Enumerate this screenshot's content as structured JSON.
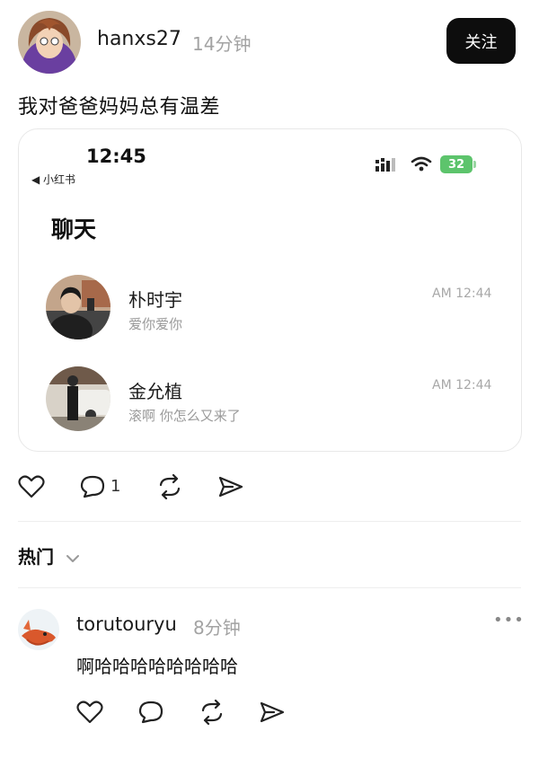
{
  "post": {
    "username": "hanxs27",
    "time": "14分钟",
    "follow_label": "关注",
    "text": "我对爸爸妈妈总有温差"
  },
  "screenshot": {
    "clock": "12:45",
    "back_label": "◀ 小红书",
    "battery": "32",
    "title": "聊天",
    "chats": [
      {
        "name": "朴时宇",
        "preview": "爱你爱你",
        "time": "AM 12:44"
      },
      {
        "name": "金允植",
        "preview": "滚啊 你怎么又来了",
        "time": "AM 12:44"
      }
    ]
  },
  "actions": {
    "comment_count": "1"
  },
  "sort": {
    "label": "热门"
  },
  "comment": {
    "username": "torutouryu",
    "time": "8分钟",
    "text": "啊哈哈哈哈哈哈哈哈",
    "more": "•••"
  }
}
